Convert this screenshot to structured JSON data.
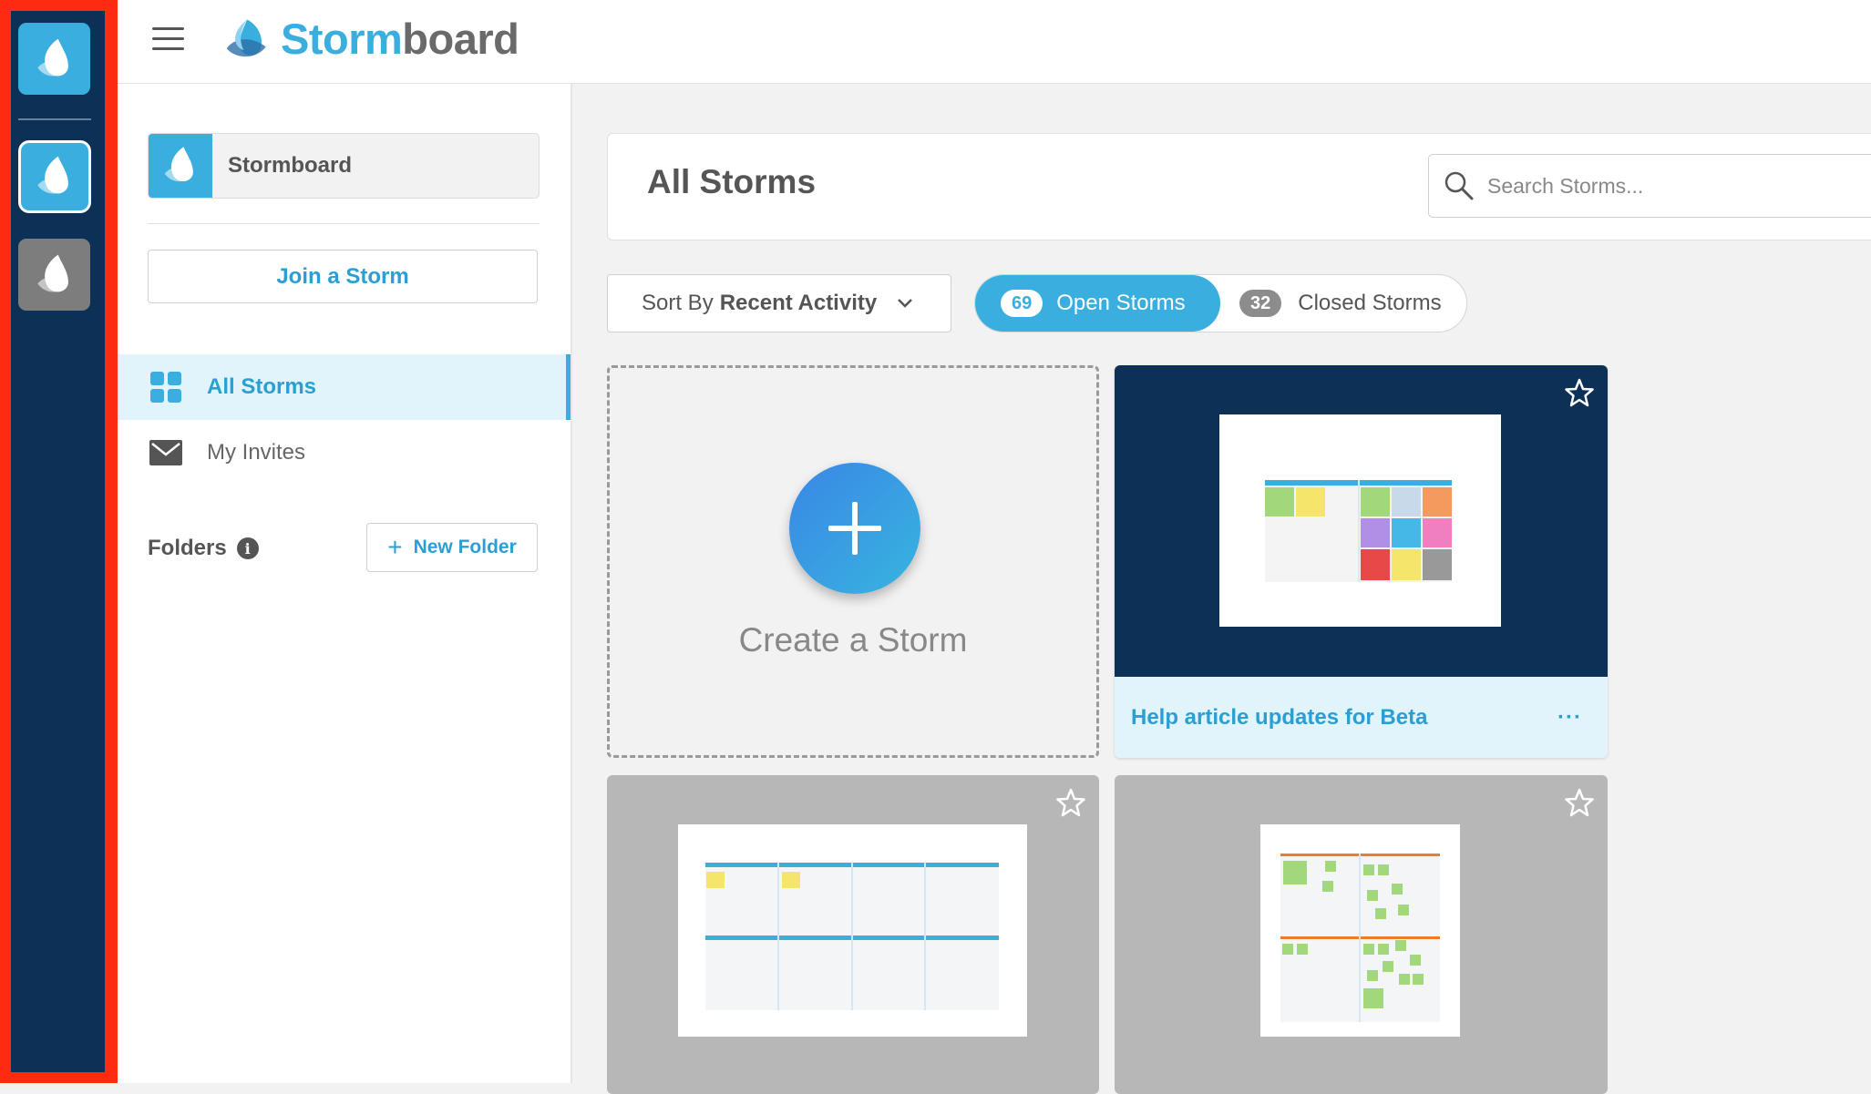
{
  "brand": {
    "name_part1": "Storm",
    "name_part2": "board"
  },
  "sidebar": {
    "org_name": "Stormboard",
    "join_button": "Join a Storm",
    "nav": [
      {
        "label": "All Storms",
        "icon": "grid-icon",
        "active": true
      },
      {
        "label": "My Invites",
        "icon": "envelope-icon",
        "active": false
      }
    ],
    "folders_label": "Folders",
    "info_glyph": "i",
    "new_folder_button": "New Folder"
  },
  "main": {
    "title": "All Storms",
    "search_placeholder": "Search Storms...",
    "sort": {
      "prefix": "Sort By",
      "value": "Recent Activity"
    },
    "tabs": [
      {
        "count": "69",
        "label": "Open Storms",
        "active": true
      },
      {
        "count": "32",
        "label": "Closed Storms",
        "active": false
      }
    ],
    "create_label": "Create a Storm",
    "cards": [
      {
        "title": "Help article updates for Beta",
        "more": "···"
      }
    ]
  },
  "colors": {
    "accent": "#3aaede",
    "rail": "#0d3057",
    "highlight_border": "#ff2a12",
    "active_bg": "#e1f4fb"
  }
}
